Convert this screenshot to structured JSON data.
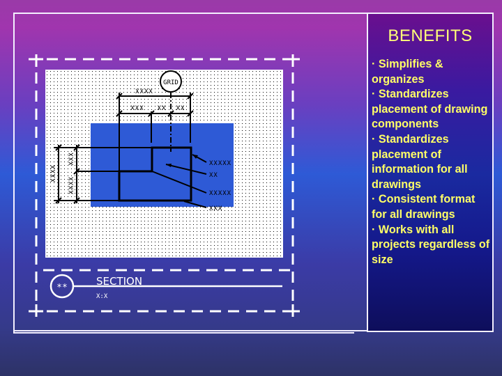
{
  "slide": {
    "benefits": {
      "title": "BENEFITS",
      "items": [
        "· Simplifies & organizes",
        "· Standardizes placement of drawing components",
        "· Standardizes placement of information for all drawings",
        "· Consistent format for all drawings",
        "· Works with all projects regardless of size"
      ]
    },
    "drawing": {
      "grid_bubble": "GRID",
      "dim_top_overall": "XXXX",
      "dim_top_segments": [
        "XXX",
        "XX",
        "XX"
      ],
      "dim_left_overall": "XXXX",
      "dim_left_segments": [
        "XXX",
        "XXXX"
      ],
      "callouts": [
        "XXXXX",
        "XX",
        "XXXXX",
        "XXX"
      ],
      "section_bubble": "**",
      "section_title": "SECTION",
      "section_scale": "X:X"
    },
    "colors": {
      "title_text": "#ffff78",
      "body_text": "#ffff66",
      "frame": "#f4f0ff",
      "drawing_area_fill": "#2e5ad6"
    }
  }
}
